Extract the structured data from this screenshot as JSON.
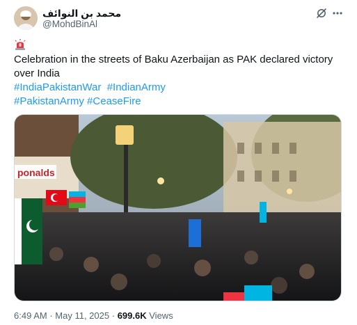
{
  "author": {
    "display_name": "محمد بن النوائف",
    "handle": "@MohdBinAl",
    "avatar_icon": "profile-avatar"
  },
  "header_icons": {
    "grok": "grok-icon",
    "more": "more-icon"
  },
  "tweet": {
    "emoji": "rotating-light-siren",
    "text_line1": "Celebration in the streets of Baku Azerbaijan  as PAK declared victory",
    "text_line2": "over India",
    "hashtags": [
      "#IndiaPakistanWar",
      "#IndianArmy",
      "#PakistanArmy",
      "#CeaseFire"
    ]
  },
  "media": {
    "description_icon": "video-thumbnail",
    "sign_text": "ponalds"
  },
  "meta": {
    "time": "6:49 AM",
    "separator1": "·",
    "date": "May 11, 2025",
    "separator2": "·",
    "views_count": "699.6K",
    "views_label": "Views"
  },
  "colors": {
    "link": "#1d9bf0",
    "secondary_text": "#536471",
    "primary_text": "#0f1419"
  }
}
